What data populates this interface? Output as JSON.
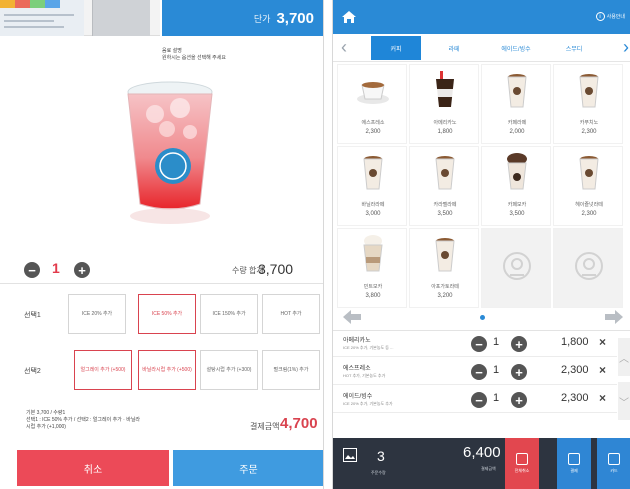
{
  "left": {
    "header": {
      "unit_label": "단가",
      "unit_price": "3,700"
    },
    "description": "음료 설명\n원하시는 옵션을 선택해 주세요",
    "quantity": {
      "value": "1",
      "sum_label": "수량 합계",
      "sum_value": "3,700"
    },
    "option_rows": [
      {
        "label": "선택1",
        "options": [
          "ICE 20% 추가",
          "ICE 50% 추가",
          "ICE 150% 추가",
          "HOT 추가"
        ],
        "selected": 1
      },
      {
        "label": "선택2",
        "options": [
          "얼그레이 추가 (+500)",
          "바닐라시럽 추가 (+500)",
          "설탕시럽 추가 (+300)",
          "펄크림(1%) 추가"
        ],
        "selected": [
          0,
          1
        ]
      }
    ],
    "summary": "기본 3,700 / 수량1\n선택1 : ICE 50% 추가 / 선택2 : 얼그레이 추가 · 바닐라\n시럽 추가 (+1,000)",
    "total_label": "결제금액",
    "total_value": "4,700",
    "cancel_label": "취소",
    "order_label": "주문"
  },
  "right": {
    "topbar": {
      "info_label": "사용안내"
    },
    "tabs": [
      "커피",
      "라떼",
      "에이드/빙수",
      "스무디"
    ],
    "active_tab": 0,
    "menu": [
      {
        "name": "에스프레소",
        "price": "2,300",
        "kind": "cup-saucer"
      },
      {
        "name": "아메리카노",
        "price": "1,800",
        "kind": "dark"
      },
      {
        "name": "카페라떼",
        "price": "2,000",
        "kind": "latte"
      },
      {
        "name": "카푸치노",
        "price": "2,300",
        "kind": "latte"
      },
      {
        "name": "바닐라라떼",
        "price": "3,000",
        "kind": "latte"
      },
      {
        "name": "카라멜라떼",
        "price": "3,500",
        "kind": "latte"
      },
      {
        "name": "카페모카",
        "price": "3,500",
        "kind": "mocha"
      },
      {
        "name": "헤이즐넛라떼",
        "price": "2,300",
        "kind": "latte"
      },
      {
        "name": "민트모카",
        "price": "3,800",
        "kind": "cream"
      },
      {
        "name": "아포가토라떼",
        "price": "3,200",
        "kind": "latte"
      },
      {
        "name": "",
        "price": "",
        "kind": "empty"
      },
      {
        "name": "",
        "price": "",
        "kind": "empty"
      }
    ],
    "orders": [
      {
        "name": "아메리카노",
        "sub": "ICE 20% 추가, 기본농도 등 ...",
        "qty": "1",
        "price": "1,800"
      },
      {
        "name": "에스프레소",
        "sub": "HOT 추가, 기본농도 추가",
        "qty": "1",
        "price": "2,300"
      },
      {
        "name": "에이드/빙수",
        "sub": "ICE 20% 추가, 기본농도 추가",
        "qty": "1",
        "price": "2,300"
      }
    ],
    "bottombar": {
      "count": "3",
      "count_label": "주문수량",
      "total": "6,400",
      "total_label": "결제금액",
      "btn1": "전체취소",
      "btn2": "결제",
      "btn3": "카드"
    }
  },
  "colors": {
    "primary": "#2a8ad6",
    "danger": "#ec4a58",
    "bottom": "#2d3440"
  },
  "icons": [
    "home-icon",
    "info-icon",
    "minus-icon",
    "plus-icon",
    "close-icon",
    "chevron-left-icon",
    "chevron-right-icon",
    "photo-icon",
    "trash-icon",
    "wallet-icon",
    "card-icon",
    "cafe-placeholder-icon"
  ]
}
